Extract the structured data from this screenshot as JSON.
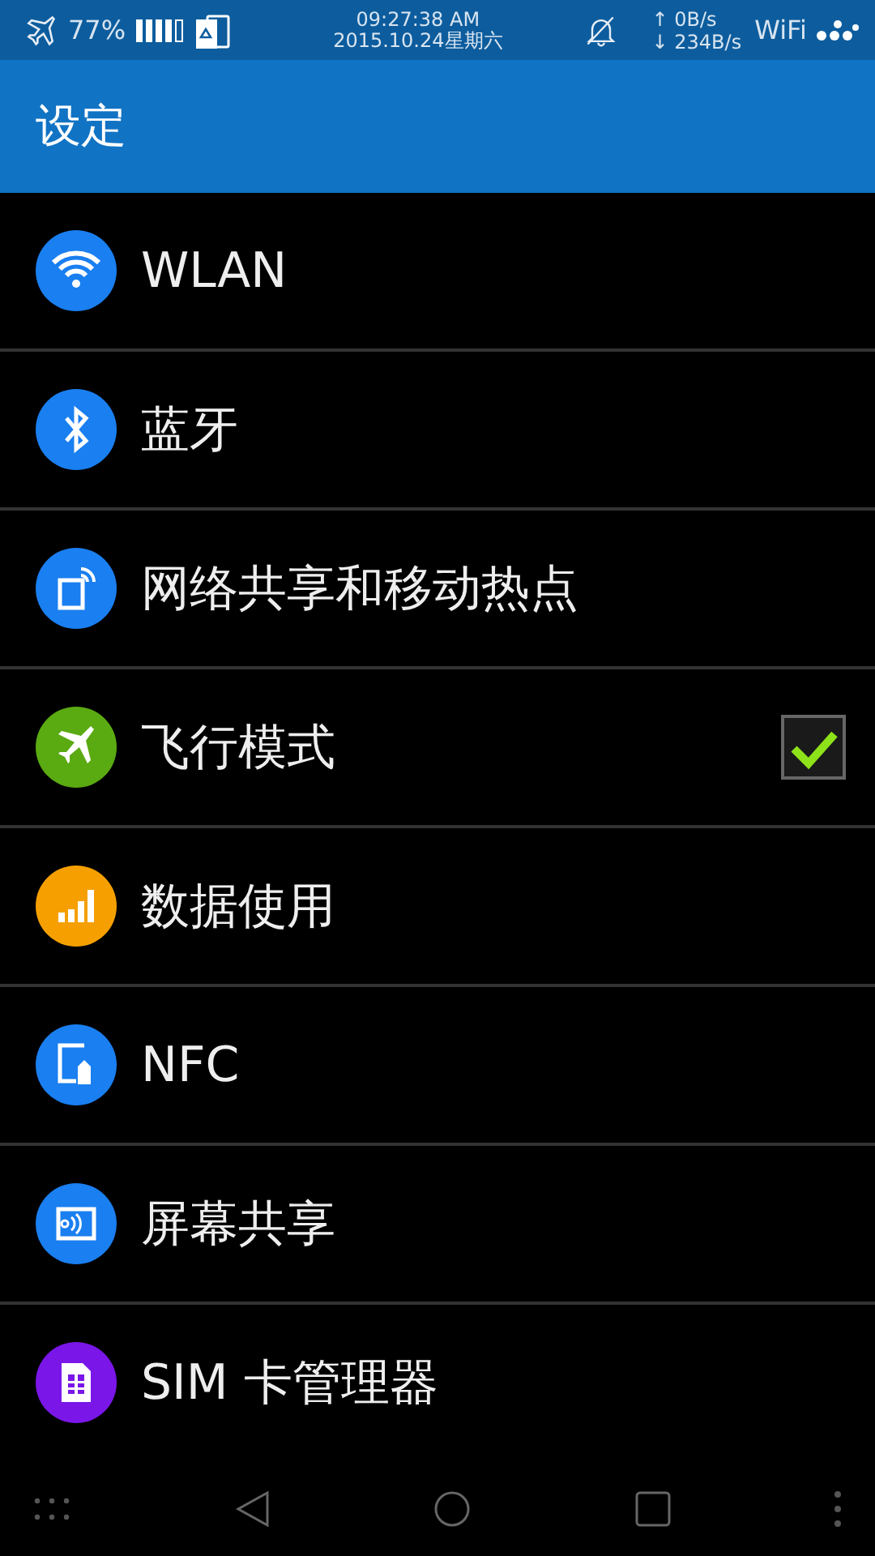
{
  "status_bar": {
    "battery_percent": "77%",
    "time": "09:27:38  AM",
    "date": "2015.10.24星期六",
    "upload": "↑ 0B/s",
    "download": "↓ 234B/s",
    "network": "WiFi"
  },
  "header": {
    "title": "设定"
  },
  "items": [
    {
      "label": "WLAN",
      "color": "#1a7ff0",
      "kind": "plain"
    },
    {
      "label": "蓝牙",
      "color": "#1a7ff0",
      "kind": "plain"
    },
    {
      "label": "网络共享和移动热点",
      "color": "#1a7ff0",
      "kind": "plain"
    },
    {
      "label": "飞行模式",
      "color": "#5aaa12",
      "kind": "checkbox",
      "checked": true
    },
    {
      "label": "数据使用",
      "color": "#f5a000",
      "kind": "plain"
    },
    {
      "label": "NFC",
      "color": "#1a7ff0",
      "kind": "plain"
    },
    {
      "label": "屏幕共享",
      "color": "#1a7ff0",
      "kind": "plain"
    },
    {
      "label": "SIM 卡管理器",
      "color": "#7a16e8",
      "kind": "plain"
    }
  ]
}
